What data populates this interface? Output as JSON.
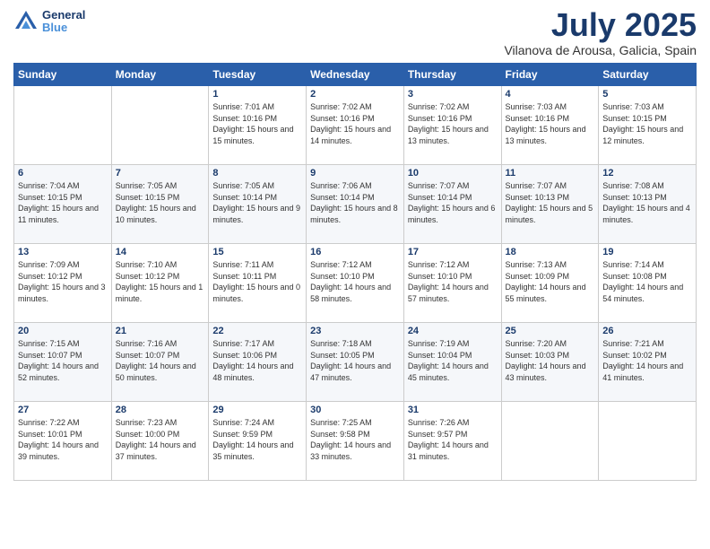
{
  "header": {
    "logo": {
      "general": "General",
      "blue": "Blue"
    },
    "month": "July 2025",
    "location": "Vilanova de Arousa, Galicia, Spain"
  },
  "weekdays": [
    "Sunday",
    "Monday",
    "Tuesday",
    "Wednesday",
    "Thursday",
    "Friday",
    "Saturday"
  ],
  "weeks": [
    [
      {
        "day": null
      },
      {
        "day": null
      },
      {
        "day": 1,
        "sunrise": "7:01 AM",
        "sunset": "10:16 PM",
        "daylight": "15 hours and 15 minutes."
      },
      {
        "day": 2,
        "sunrise": "7:02 AM",
        "sunset": "10:16 PM",
        "daylight": "15 hours and 14 minutes."
      },
      {
        "day": 3,
        "sunrise": "7:02 AM",
        "sunset": "10:16 PM",
        "daylight": "15 hours and 13 minutes."
      },
      {
        "day": 4,
        "sunrise": "7:03 AM",
        "sunset": "10:16 PM",
        "daylight": "15 hours and 13 minutes."
      },
      {
        "day": 5,
        "sunrise": "7:03 AM",
        "sunset": "10:15 PM",
        "daylight": "15 hours and 12 minutes."
      }
    ],
    [
      {
        "day": 6,
        "sunrise": "7:04 AM",
        "sunset": "10:15 PM",
        "daylight": "15 hours and 11 minutes."
      },
      {
        "day": 7,
        "sunrise": "7:05 AM",
        "sunset": "10:15 PM",
        "daylight": "15 hours and 10 minutes."
      },
      {
        "day": 8,
        "sunrise": "7:05 AM",
        "sunset": "10:14 PM",
        "daylight": "15 hours and 9 minutes."
      },
      {
        "day": 9,
        "sunrise": "7:06 AM",
        "sunset": "10:14 PM",
        "daylight": "15 hours and 8 minutes."
      },
      {
        "day": 10,
        "sunrise": "7:07 AM",
        "sunset": "10:14 PM",
        "daylight": "15 hours and 6 minutes."
      },
      {
        "day": 11,
        "sunrise": "7:07 AM",
        "sunset": "10:13 PM",
        "daylight": "15 hours and 5 minutes."
      },
      {
        "day": 12,
        "sunrise": "7:08 AM",
        "sunset": "10:13 PM",
        "daylight": "15 hours and 4 minutes."
      }
    ],
    [
      {
        "day": 13,
        "sunrise": "7:09 AM",
        "sunset": "10:12 PM",
        "daylight": "15 hours and 3 minutes."
      },
      {
        "day": 14,
        "sunrise": "7:10 AM",
        "sunset": "10:12 PM",
        "daylight": "15 hours and 1 minute."
      },
      {
        "day": 15,
        "sunrise": "7:11 AM",
        "sunset": "10:11 PM",
        "daylight": "15 hours and 0 minutes."
      },
      {
        "day": 16,
        "sunrise": "7:12 AM",
        "sunset": "10:10 PM",
        "daylight": "14 hours and 58 minutes."
      },
      {
        "day": 17,
        "sunrise": "7:12 AM",
        "sunset": "10:10 PM",
        "daylight": "14 hours and 57 minutes."
      },
      {
        "day": 18,
        "sunrise": "7:13 AM",
        "sunset": "10:09 PM",
        "daylight": "14 hours and 55 minutes."
      },
      {
        "day": 19,
        "sunrise": "7:14 AM",
        "sunset": "10:08 PM",
        "daylight": "14 hours and 54 minutes."
      }
    ],
    [
      {
        "day": 20,
        "sunrise": "7:15 AM",
        "sunset": "10:07 PM",
        "daylight": "14 hours and 52 minutes."
      },
      {
        "day": 21,
        "sunrise": "7:16 AM",
        "sunset": "10:07 PM",
        "daylight": "14 hours and 50 minutes."
      },
      {
        "day": 22,
        "sunrise": "7:17 AM",
        "sunset": "10:06 PM",
        "daylight": "14 hours and 48 minutes."
      },
      {
        "day": 23,
        "sunrise": "7:18 AM",
        "sunset": "10:05 PM",
        "daylight": "14 hours and 47 minutes."
      },
      {
        "day": 24,
        "sunrise": "7:19 AM",
        "sunset": "10:04 PM",
        "daylight": "14 hours and 45 minutes."
      },
      {
        "day": 25,
        "sunrise": "7:20 AM",
        "sunset": "10:03 PM",
        "daylight": "14 hours and 43 minutes."
      },
      {
        "day": 26,
        "sunrise": "7:21 AM",
        "sunset": "10:02 PM",
        "daylight": "14 hours and 41 minutes."
      }
    ],
    [
      {
        "day": 27,
        "sunrise": "7:22 AM",
        "sunset": "10:01 PM",
        "daylight": "14 hours and 39 minutes."
      },
      {
        "day": 28,
        "sunrise": "7:23 AM",
        "sunset": "10:00 PM",
        "daylight": "14 hours and 37 minutes."
      },
      {
        "day": 29,
        "sunrise": "7:24 AM",
        "sunset": "9:59 PM",
        "daylight": "14 hours and 35 minutes."
      },
      {
        "day": 30,
        "sunrise": "7:25 AM",
        "sunset": "9:58 PM",
        "daylight": "14 hours and 33 minutes."
      },
      {
        "day": 31,
        "sunrise": "7:26 AM",
        "sunset": "9:57 PM",
        "daylight": "14 hours and 31 minutes."
      },
      {
        "day": null
      },
      {
        "day": null
      }
    ]
  ]
}
